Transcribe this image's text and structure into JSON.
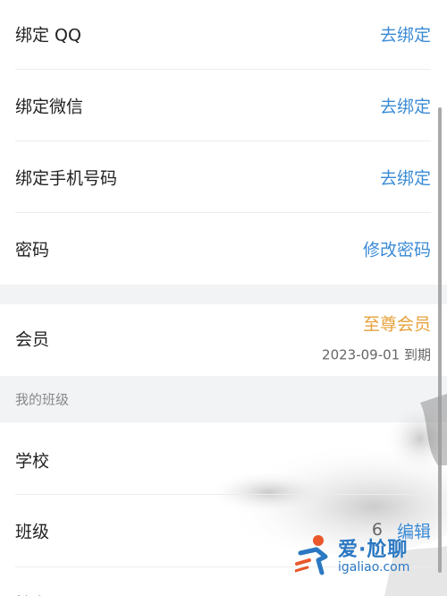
{
  "account": {
    "bind_qq": {
      "label": "绑定 QQ",
      "action": "去绑定"
    },
    "bind_wechat": {
      "label": "绑定微信",
      "action": "去绑定"
    },
    "bind_phone": {
      "label": "绑定手机号码",
      "action": "去绑定"
    },
    "password": {
      "label": "密码",
      "action": "修改密码"
    }
  },
  "membership": {
    "label": "会员",
    "level": "至尊会员",
    "expiry": "2023-09-01 到期"
  },
  "my_class": {
    "section_title": "我的班级",
    "school": {
      "label": "学校"
    },
    "class": {
      "label": "班级",
      "value": "6",
      "action": "编辑"
    },
    "partial_next": {
      "label": "性名"
    }
  },
  "watermark": {
    "text": "爱·尬聊",
    "url": "igaliao.com"
  },
  "colors": {
    "link": "#3a8bd6",
    "vip": "#e6a23c",
    "section_bg": "#f2f3f5"
  }
}
